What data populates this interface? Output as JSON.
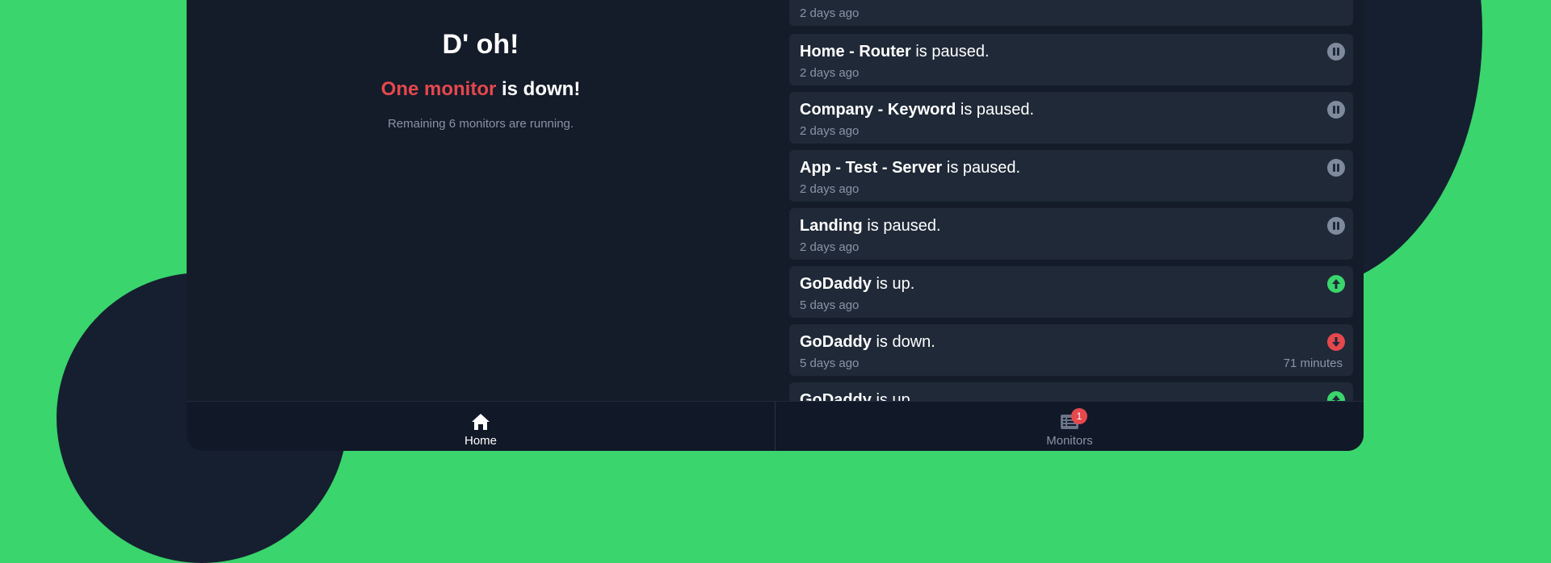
{
  "status": {
    "title": "D' oh!",
    "down_highlight": "One monitor",
    "down_rest": " is down!",
    "note": "Remaining 6 monitors are running."
  },
  "events": [
    {
      "name": "Home - Router",
      "suffix": " is paused.",
      "time": "2 days ago",
      "type": "paused",
      "duration": ""
    },
    {
      "name": "Company - Keyword",
      "suffix": " is paused.",
      "time": "2 days ago",
      "type": "paused",
      "duration": ""
    },
    {
      "name": "App - Test - Server",
      "suffix": " is paused.",
      "time": "2 days ago",
      "type": "paused",
      "duration": ""
    },
    {
      "name": "Landing",
      "suffix": " is paused.",
      "time": "2 days ago",
      "type": "paused",
      "duration": ""
    },
    {
      "name": "GoDaddy",
      "suffix": " is up.",
      "time": "5 days ago",
      "type": "up",
      "duration": ""
    },
    {
      "name": "GoDaddy",
      "suffix": " is down.",
      "time": "5 days ago",
      "type": "down",
      "duration": "71 minutes"
    },
    {
      "name": "GoDaddy",
      "suffix": " is up.",
      "time": "",
      "type": "up",
      "duration": ""
    }
  ],
  "partial_top_event": {
    "time": "2 days ago"
  },
  "nav": {
    "home_label": "Home",
    "monitors_label": "Monitors",
    "monitors_badge": "1"
  },
  "colors": {
    "background": "#3ad56c",
    "panel": "#141b29",
    "card": "#1f2937",
    "down": "#e5484d",
    "up": "#3ad56c",
    "paused": "#7f8a9c"
  }
}
